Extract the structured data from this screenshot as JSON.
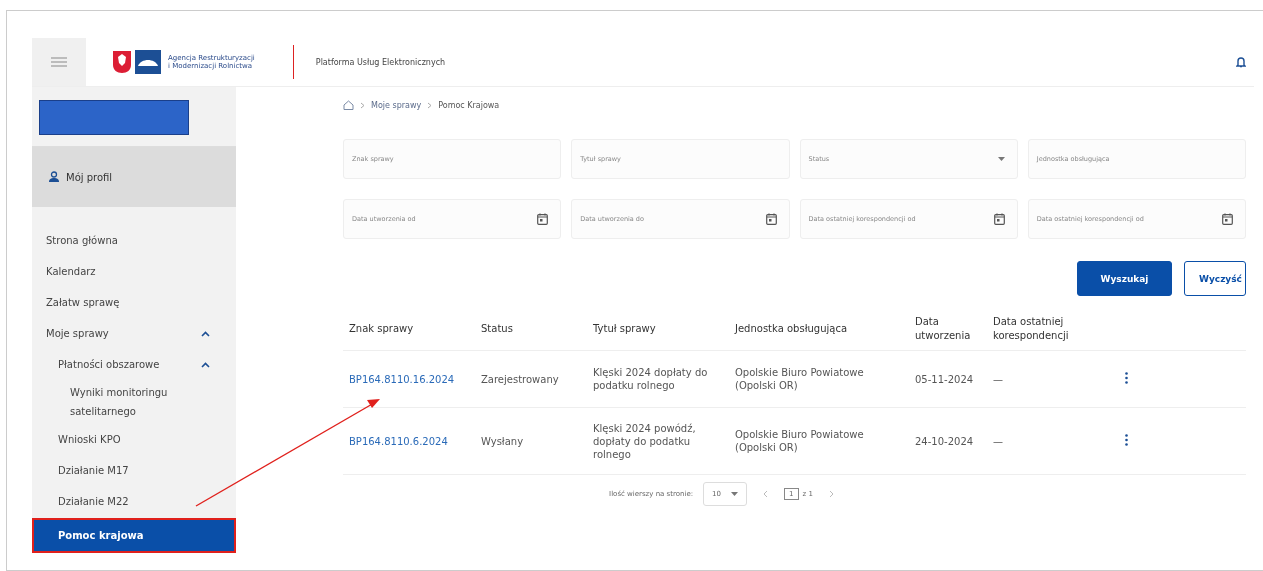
{
  "header": {
    "agency": "Agencja Restrukturyzacji\ni Modernizacji Rolnictwa",
    "platform": "Platforma Usług Elektronicznych"
  },
  "sidebar": {
    "profile": "Mój profil",
    "items": [
      {
        "label": "Strona główna",
        "selected": false
      },
      {
        "label": "Kalendarz",
        "selected": false
      },
      {
        "label": "Załatw sprawę",
        "selected": false
      },
      {
        "label": "Moje sprawy",
        "selected": false,
        "expanded": true,
        "children": [
          {
            "label": "Płatności obszarowe",
            "selected": false,
            "expanded": true,
            "children": [
              {
                "label": "Wyniki monitoringu satelitarnego",
                "selected": false
              }
            ]
          },
          {
            "label": "Wnioski KPO",
            "selected": false
          },
          {
            "label": "Działanie M17",
            "selected": false
          },
          {
            "label": "Działanie M22",
            "selected": false
          }
        ]
      },
      {
        "label": "Pomoc krajowa",
        "selected": true
      }
    ]
  },
  "breadcrumb": [
    "Moje sprawy",
    "Pomoc Krajowa"
  ],
  "filters": [
    {
      "kind": "text",
      "placeholder": "Znak sprawy"
    },
    {
      "kind": "text",
      "placeholder": "Tytuł sprawy"
    },
    {
      "kind": "select",
      "placeholder": "Status"
    },
    {
      "kind": "text",
      "placeholder": "Jednostka obsługująca"
    },
    {
      "kind": "date",
      "placeholder": "Data utworzenia od"
    },
    {
      "kind": "date",
      "placeholder": "Data utworzenia do"
    },
    {
      "kind": "date",
      "placeholder": "Data ostatniej korespondencji od"
    },
    {
      "kind": "date",
      "placeholder": "Data ostatniej korespondencji od"
    }
  ],
  "buttons": {
    "search": "Wyszukaj",
    "clear": "Wyczyść"
  },
  "table": {
    "columns": [
      "Znak sprawy",
      "Status",
      "Tytuł sprawy",
      "Jednostka obsługująca",
      "Data utworzenia",
      "Data ostatniej korespondencji"
    ],
    "rows": [
      [
        "BP164.8110.16.2024",
        "Zarejestrowany",
        "Klęski 2024 dopłaty do podatku rolnego",
        "Opolskie Biuro Powiatowe (Opolski OR)",
        "05-11-2024",
        "—"
      ],
      [
        "BP164.8110.6.2024",
        "Wysłany",
        "Klęski 2024 powódź, dopłaty do podatku rolnego",
        "Opolskie Biuro Powiatowe (Opolski OR)",
        "24-10-2024",
        "—"
      ]
    ]
  },
  "pagination": {
    "rows_label": "Ilość wierszy na stronie:",
    "rows_value": "10",
    "page": "1",
    "of": "z 1"
  }
}
